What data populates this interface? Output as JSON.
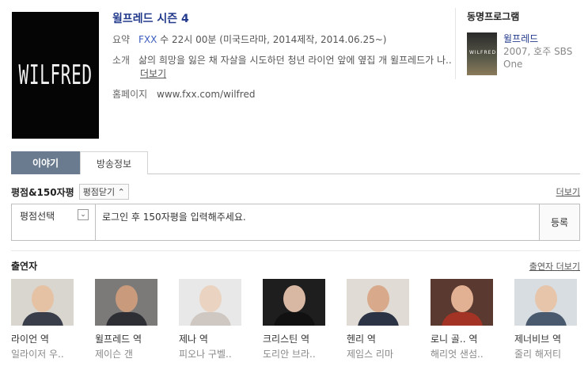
{
  "poster": {
    "text": "WILFRED"
  },
  "info": {
    "title": "윌프레드 시즌 4",
    "summary_label": "요약",
    "channel": "FXX",
    "summary_rest": " 수 22시 00분 (미국드라마, 2014제작, 2014.06.25~)",
    "intro_label": "소개",
    "intro_text": "삶의 희망을 잃은 채 자살을 시도하던 청년 라이언 앞에 옆집 개 윌프레드가 나..",
    "intro_more": "더보기",
    "homepage_label": "홈페이지",
    "homepage_url": "www.fxx.com/wilfred"
  },
  "same_program": {
    "title": "동명프로그램",
    "thumb_text": "WILFRED",
    "name": "윌프레드",
    "sub": "2007, 호주 SBS One"
  },
  "tabs": [
    {
      "label": "이야기"
    },
    {
      "label": "방송정보"
    }
  ],
  "reviews": {
    "title": "평점&150자평",
    "close_label": "평점닫기 ⌃",
    "more": "더보기",
    "rating_select": "평점선택",
    "dropdown_glyph": "⌄",
    "placeholder": "로그인 후 150자평을 입력해주세요.",
    "submit": "등록"
  },
  "cast": {
    "title": "출연자",
    "more": "출연자 더보기",
    "members": [
      {
        "role": "라이언 역",
        "actor": "일라이저 우..",
        "bg": "#d9d5cf",
        "face": "#e6c2a5",
        "clothes": "#3a3e4a"
      },
      {
        "role": "윌프레드 역",
        "actor": "제이슨 갠",
        "bg": "#7c7a78",
        "face": "#c99b7c",
        "clothes": "#2d2f35"
      },
      {
        "role": "제나 역",
        "actor": "피오나 구벨..",
        "bg": "#e8e8e8",
        "face": "#ead3c0",
        "clothes": "#cfc8c2"
      },
      {
        "role": "크리스틴 역",
        "actor": "도리안 브라..",
        "bg": "#1e1e1e",
        "face": "#d9b8a3",
        "clothes": "#111111"
      },
      {
        "role": "헨리 역",
        "actor": "제임스 리마",
        "bg": "#e0dbd4",
        "face": "#d8a98a",
        "clothes": "#2b3344"
      },
      {
        "role": "로니 골.. 역",
        "actor": "해리엇 샌섬..",
        "bg": "#5a3a30",
        "face": "#e2b092",
        "clothes": "#a33324"
      },
      {
        "role": "제너비브 역",
        "actor": "줄리 해저티",
        "bg": "#d8dde2",
        "face": "#e7c5aa",
        "clothes": "#4a5a6e"
      }
    ]
  }
}
